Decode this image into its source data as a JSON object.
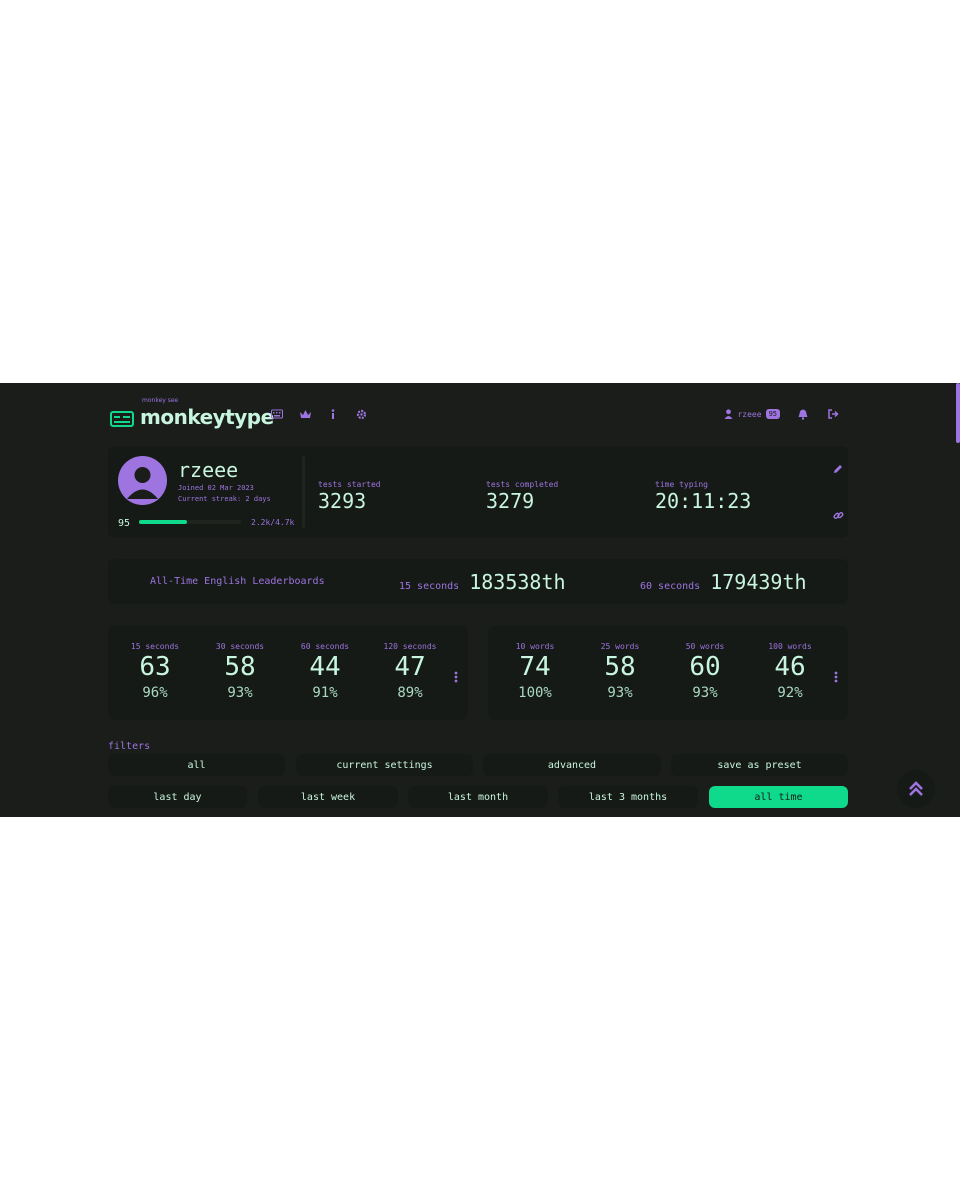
{
  "header": {
    "logo_small": "monkey see",
    "logo_title": "monkeytype",
    "nav_icons": [
      "keyboard-icon",
      "crown-icon",
      "info-icon",
      "gear-icon"
    ],
    "username": "rzeee",
    "user_level": "95",
    "right_icons": [
      "user-icon",
      "bell-icon",
      "logout-icon"
    ]
  },
  "profile": {
    "name": "rzeee",
    "joined": "Joined 02 Mar 2023",
    "streak": "Current streak: 2 days",
    "level": "95",
    "xp_text": "2.2k/4.7k",
    "xp_fraction": 0.47,
    "stats": [
      {
        "label": "tests started",
        "value": "3293"
      },
      {
        "label": "tests completed",
        "value": "3279"
      },
      {
        "label": "time typing",
        "value": "20:11:23"
      }
    ]
  },
  "leaderboards": {
    "title": "All-Time English Leaderboards",
    "items": [
      {
        "label": "15 seconds",
        "value": "183538th"
      },
      {
        "label": "60 seconds",
        "value": "179439th"
      }
    ]
  },
  "pb_time": [
    {
      "label": "15 seconds",
      "wpm": "63",
      "acc": "96%"
    },
    {
      "label": "30 seconds",
      "wpm": "58",
      "acc": "93%"
    },
    {
      "label": "60 seconds",
      "wpm": "44",
      "acc": "91%"
    },
    {
      "label": "120 seconds",
      "wpm": "47",
      "acc": "89%"
    }
  ],
  "pb_words": [
    {
      "label": "10 words",
      "wpm": "74",
      "acc": "100%"
    },
    {
      "label": "25 words",
      "wpm": "58",
      "acc": "93%"
    },
    {
      "label": "50 words",
      "wpm": "60",
      "acc": "93%"
    },
    {
      "label": "100 words",
      "wpm": "46",
      "acc": "92%"
    }
  ],
  "filters": {
    "label": "filters",
    "row1": [
      "all",
      "current settings",
      "advanced",
      "save as preset"
    ],
    "row2": [
      "last day",
      "last week",
      "last month",
      "last 3 months",
      "all time"
    ],
    "active": "all time"
  },
  "colors": {
    "accent": "#9d74e0",
    "main": "#0fd98a",
    "text": "#c8f5e0",
    "bg": "#1a1d1a"
  }
}
